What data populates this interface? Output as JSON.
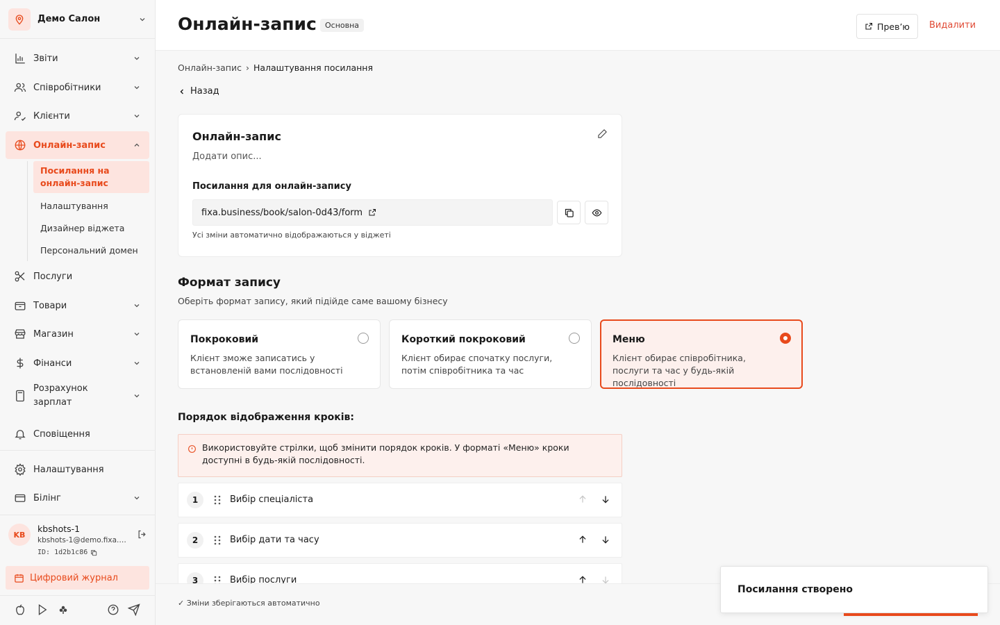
{
  "sidebar": {
    "salon_name": "Демо Салон",
    "items": [
      {
        "label": "Звіти",
        "icon": "bar-chart-icon"
      },
      {
        "label": "Співробітники",
        "icon": "users-icon"
      },
      {
        "label": "Клієнти",
        "icon": "user-check-icon"
      },
      {
        "label": "Онлайн-запис",
        "icon": "globe-icon"
      },
      {
        "label": "Послуги",
        "icon": "scissors-icon"
      },
      {
        "label": "Товари",
        "icon": "box-icon"
      },
      {
        "label": "Магазин",
        "icon": "store-icon"
      },
      {
        "label": "Фінанси",
        "icon": "dollar-icon"
      },
      {
        "label": "Розрахунок зарплат",
        "icon": "calculator-icon"
      },
      {
        "label": "Сповіщення",
        "icon": "bell-icon"
      },
      {
        "label": "Налаштування",
        "icon": "gear-icon"
      },
      {
        "label": "Білінг",
        "icon": "wallet-icon"
      }
    ],
    "subitems": [
      {
        "label": "Посилання на онлайн-запис"
      },
      {
        "label": "Налаштування"
      },
      {
        "label": "Дизайнер віджета"
      },
      {
        "label": "Персональний домен"
      }
    ],
    "user": {
      "initials": "KB",
      "name": "kbshots-1",
      "email": "kbshots-1@demo.fixa.b...",
      "id": "ID: 1d2b1c86"
    },
    "journal_label": "Цифровий журнал"
  },
  "header": {
    "title": "Онлайн-запис",
    "badge": "Основна",
    "preview_label": "Прев’ю",
    "delete_label": "Видалити"
  },
  "breadcrumb": {
    "root": "Онлайн-запис",
    "separator": "›",
    "current": "Налаштування посилання"
  },
  "back_label": "Назад",
  "link_card": {
    "title": "Онлайн-запис",
    "description_placeholder": "Додати опис...",
    "link_label": "Посилання для онлайн-запису",
    "url": "fixa.business/book/salon-0d43/form",
    "note": "Усі зміни автоматично відображаються у віджеті"
  },
  "format_section": {
    "title": "Формат запису",
    "subtitle": "Оберіть формат запису, який підійде саме вашому бізнесу",
    "options": [
      {
        "title": "Покроковий",
        "description": "Клієнт зможе записатись у встановленій вами послідовності",
        "selected": false
      },
      {
        "title": "Короткий покроковий",
        "description": "Клієнт обирає спочатку послуги, потім співробітника та час",
        "selected": false
      },
      {
        "title": "Меню",
        "description": "Клієнт обирає співробітника, послуги та час у будь-якій послідовності",
        "selected": true
      }
    ]
  },
  "steps_section": {
    "title": "Порядок відображення кроків:",
    "hint": "Використовуйте стрілки, щоб змінити порядок кроків. У форматі «Меню» кроки доступні в будь-якій послідовності.",
    "steps": [
      {
        "num": "1",
        "label": "Вибір спеціаліста",
        "up_enabled": false,
        "down_enabled": true
      },
      {
        "num": "2",
        "label": "Вибір дати та часу",
        "up_enabled": true,
        "down_enabled": true
      },
      {
        "num": "3",
        "label": "Вибір послуги",
        "up_enabled": true,
        "down_enabled": false
      }
    ]
  },
  "footer": {
    "note": "✓ Зміни зберігаються автоматично"
  },
  "toast": {
    "message": "Посилання створено"
  },
  "colors": {
    "accent": "#e84a1c",
    "accent_light": "#fde4df",
    "danger": "#e04a35"
  }
}
